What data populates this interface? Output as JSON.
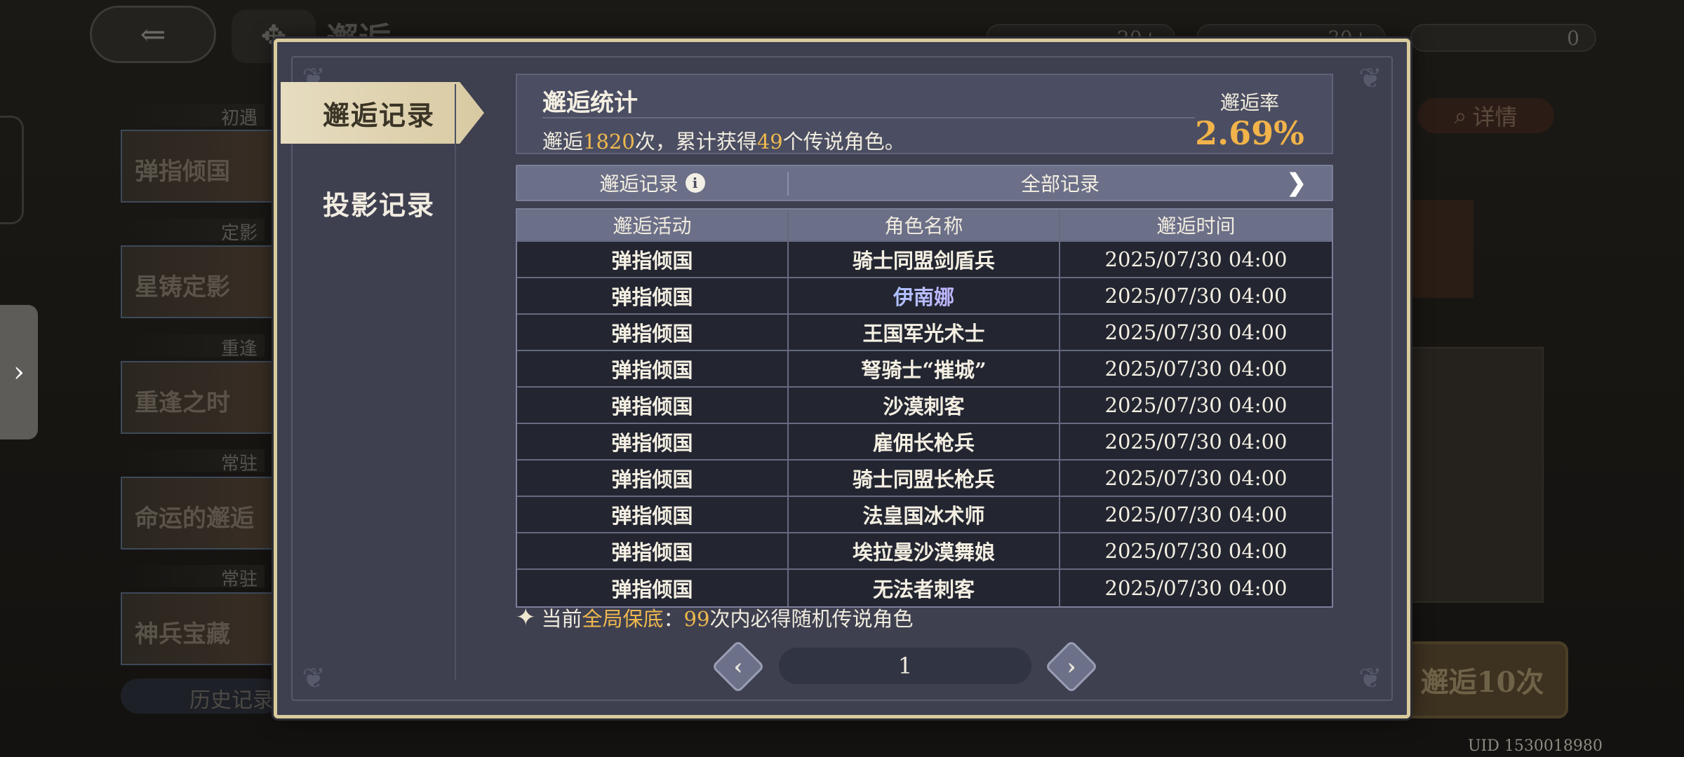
{
  "background": {
    "title": "邂逅",
    "currencies": [
      "20+",
      "30+",
      "0"
    ],
    "banners": [
      {
        "tag": "初遇",
        "name": "弹指倾国"
      },
      {
        "tag": "定影",
        "name": "星铸定影"
      },
      {
        "tag": "重逢",
        "name": "重逢之时"
      },
      {
        "tag": "常驻",
        "name": "命运的邂逅"
      },
      {
        "tag": "常驻",
        "name": "神兵宝藏"
      }
    ],
    "history_label": "历史记录",
    "detail_label": "详情",
    "summon10_label": "邂逅10次",
    "uid": "UID 1530018980"
  },
  "modal": {
    "tabs": [
      {
        "label": "邂逅记录",
        "active": true
      },
      {
        "label": "投影记录",
        "active": false
      }
    ],
    "stats": {
      "title": "邂逅统计",
      "text_prefix": "邂逅",
      "count": "1820",
      "text_mid": "次，累计获得",
      "legend_count": "49",
      "text_suffix": "个传说角色。",
      "rate_label": "邂逅率",
      "rate_value": "2.69%"
    },
    "filter": {
      "left_label": "邂逅记录",
      "right_label": "全部记录"
    },
    "table": {
      "headers": [
        "邂逅活动",
        "角色名称",
        "邂逅时间"
      ],
      "rows": [
        {
          "activity": "弹指倾国",
          "name": "骑士同盟剑盾兵",
          "time": "2025/07/30 04:00"
        },
        {
          "activity": "弹指倾国",
          "name": "伊南娜",
          "time": "2025/07/30 04:00"
        },
        {
          "activity": "弹指倾国",
          "name": "王国军光术士",
          "time": "2025/07/30 04:00"
        },
        {
          "activity": "弹指倾国",
          "name": "弩骑士“摧城”",
          "time": "2025/07/30 04:00"
        },
        {
          "activity": "弹指倾国",
          "name": "沙漠刺客",
          "time": "2025/07/30 04:00"
        },
        {
          "activity": "弹指倾国",
          "name": "雇佣长枪兵",
          "time": "2025/07/30 04:00"
        },
        {
          "activity": "弹指倾国",
          "name": "骑士同盟长枪兵",
          "time": "2025/07/30 04:00"
        },
        {
          "activity": "弹指倾国",
          "name": "法皇国冰术师",
          "time": "2025/07/30 04:00"
        },
        {
          "activity": "弹指倾国",
          "name": "埃拉曼沙漠舞娘",
          "time": "2025/07/30 04:00"
        },
        {
          "activity": "弹指倾国",
          "name": "无法者刺客",
          "time": "2025/07/30 04:00"
        }
      ]
    },
    "guarantee": {
      "prefix": "当前",
      "highlight": "全局保底",
      "colon": "：",
      "count": "99",
      "suffix": "次内必得随机传说角色"
    },
    "pager": {
      "page": "1"
    }
  },
  "colors": {
    "highlight": "#f0b84e",
    "rare_name_gradient": [
      "#8fd3ff",
      "#e0a3ff"
    ],
    "frame_gold": "#d8cb9c"
  },
  "icons": [
    "back-arrow-icon",
    "home-icon",
    "info-icon",
    "chevron-right-icon",
    "sparkle-star-icon",
    "prev-page-icon",
    "next-page-icon",
    "magnifier-icon"
  ]
}
